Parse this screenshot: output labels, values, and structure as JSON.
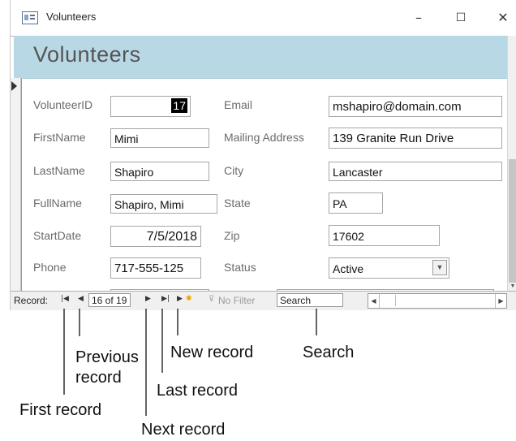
{
  "window": {
    "title": "Volunteers",
    "controls": {
      "minimize": "–",
      "maximize": "☐",
      "close": "✕"
    }
  },
  "form": {
    "header_title": "Volunteers",
    "fields": {
      "volunteer_id": {
        "label": "VolunteerID",
        "value": "17"
      },
      "first_name": {
        "label": "FirstName",
        "value": "Mimi"
      },
      "last_name": {
        "label": "LastName",
        "value": "Shapiro"
      },
      "full_name": {
        "label": "FullName",
        "value": "Shapiro,  Mimi"
      },
      "start_date": {
        "label": "StartDate",
        "value": "7/5/2018"
      },
      "phone": {
        "label": "Phone",
        "value": "717-555-125"
      },
      "email": {
        "label": "Email",
        "value": "mshapiro@domain.com"
      },
      "mailing_address": {
        "label": "Mailing Address",
        "value": "139 Granite Run Drive"
      },
      "city": {
        "label": "City",
        "value": "Lancaster"
      },
      "state": {
        "label": "State",
        "value": "PA"
      },
      "zip": {
        "label": "Zip",
        "value": "17602"
      },
      "status": {
        "label": "Status",
        "value": "Active"
      }
    }
  },
  "navigation": {
    "label": "Record:",
    "first_icon": "first-record-icon",
    "prev_icon": "previous-record-icon",
    "position": "16 of 19",
    "next_icon": "next-record-icon",
    "last_icon": "last-record-icon",
    "new_icon": "new-record-icon",
    "filter_label": "No Filter",
    "search_value": "Search"
  },
  "annotations": {
    "previous_record": [
      "Previous",
      "record"
    ],
    "new_record": "New record",
    "search": "Search",
    "last_record": "Last record",
    "first_record": "First record",
    "next_record": "Next record"
  },
  "colors": {
    "header_band": "#b9d8e6",
    "title_bar_accent": "#c0504d",
    "selected_id_bg": "#000000",
    "new_record_star": "#e5a000"
  }
}
